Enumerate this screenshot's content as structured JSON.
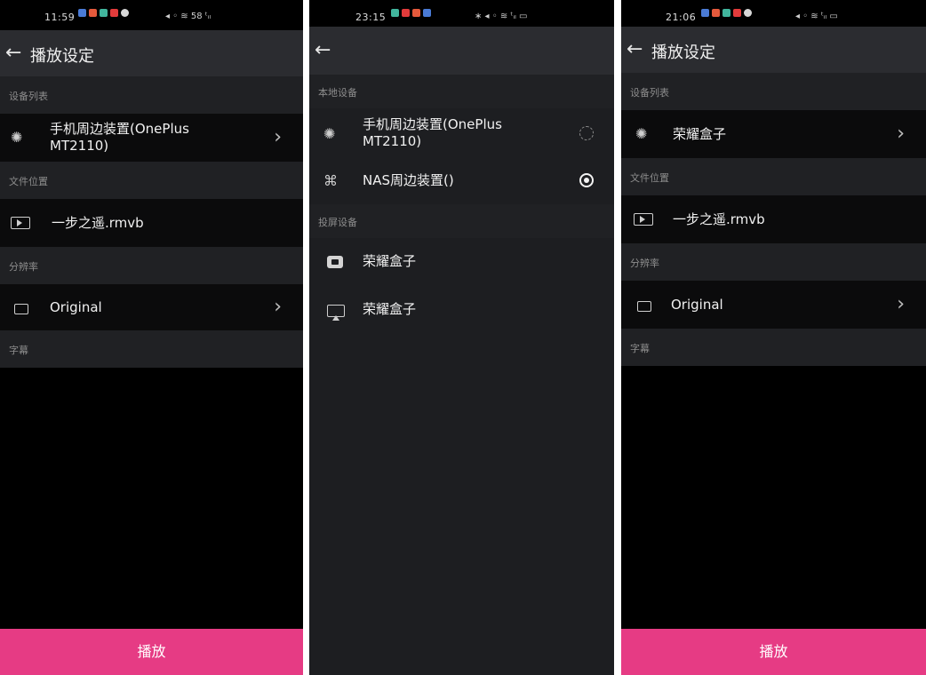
{
  "panels": [
    {
      "status": {
        "time": "11:59",
        "right": "◂ ◦ ≋ 58 ᵗᵢₗ"
      },
      "header": {
        "back": "←",
        "title": "播放设定"
      },
      "sections": [
        "设备列表",
        "文件位置",
        "分辨率",
        "字幕"
      ],
      "rows": {
        "device": "手机周边装置(OnePlus MT2110)",
        "file": "一步之遥.rmvb",
        "resolution": "Original"
      },
      "play_label": "播放"
    },
    {
      "status": {
        "time": "23:15",
        "right": "∗ ◂ ◦ ≋ ᵗᵢₗ ▭"
      },
      "header": {
        "back": "←"
      },
      "sections": [
        "本地设备",
        "投屏设备"
      ],
      "local_devices": [
        "手机周边装置(OnePlus MT2110)",
        "NAS周边装置()"
      ],
      "cast_devices": [
        "荣耀盒子",
        "荣耀盒子"
      ]
    },
    {
      "status": {
        "time": "21:06",
        "right": "◂ ◦ ≋ ᵗᵢₗ ▭"
      },
      "header": {
        "back": "←",
        "title": "播放设定"
      },
      "sections": [
        "设备列表",
        "文件位置",
        "分辨率",
        "字幕"
      ],
      "rows": {
        "device": "荣耀盒子",
        "file": "一步之遥.rmvb",
        "resolution": "Original"
      },
      "play_label": "播放"
    }
  ],
  "colors": {
    "accent": "#e63b84",
    "appbar": "#2b2c30",
    "section": "#202124"
  }
}
